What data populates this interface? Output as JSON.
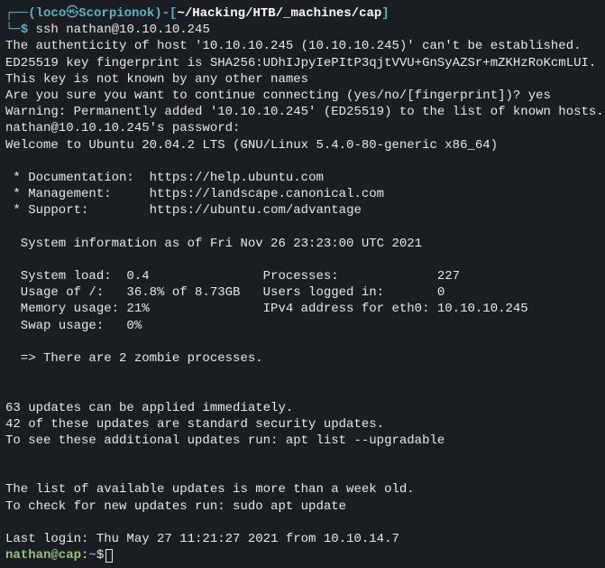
{
  "header": {
    "open_paren": "┌──(",
    "user": "loco",
    "at": "㉿",
    "host": "Scorpionok",
    "close_paren": ")-[",
    "cwd": "~/Hacking/HTB/_machines/cap",
    "end_bracket": "]"
  },
  "prompt1": {
    "corner": "└─",
    "dollar": "$ "
  },
  "cmd1": "ssh nathan@10.10.10.245",
  "body": {
    "l1": "The authenticity of host '10.10.10.245 (10.10.10.245)' can't be established.",
    "l2": "ED25519 key fingerprint is SHA256:UDhIJpyIePItP3qjtVVU+GnSyAZSr+mZKHzRoKcmLUI.",
    "l3": "This key is not known by any other names",
    "l4": "Are you sure you want to continue connecting (yes/no/[fingerprint])? yes",
    "l5": "Warning: Permanently added '10.10.10.245' (ED25519) to the list of known hosts.",
    "l6": "nathan@10.10.10.245's password:",
    "l7": "Welcome to Ubuntu 20.04.2 LTS (GNU/Linux 5.4.0-80-generic x86_64)",
    "doc": " * Documentation:  ",
    "doc_url": "https://help.ubuntu.com",
    "mgmt": " * Management:     ",
    "mgmt_url": "https://landscape.canonical.com",
    "sup": " * Support:        ",
    "sup_url": "https://ubuntu.com/advantage",
    "sysinfo": "  System information as of Fri Nov 26 23:23:00 UTC 2021",
    "row1": "  System load:  0.4               Processes:             227",
    "row2": "  Usage of /:   36.8% of 8.73GB   Users logged in:       0",
    "row3": "  Memory usage: 21%               IPv4 address for eth0: 10.10.10.245",
    "row4": "  Swap usage:   0%",
    "zombie": "  => There are 2 zombie processes.",
    "u1": "63 updates can be applied immediately.",
    "u2": "42 of these updates are standard security updates.",
    "u3": "To see these additional updates run: apt list --upgradable",
    "old1": "The list of available updates is more than a week old.",
    "old2": "To check for new updates run: sudo apt update",
    "last": "Last login: Thu May 27 11:21:27 2021 from 10.10.14.7"
  },
  "prompt2": {
    "user": "nathan@cap",
    "colon": ":",
    "tilde": "~",
    "dollar": "$ "
  }
}
